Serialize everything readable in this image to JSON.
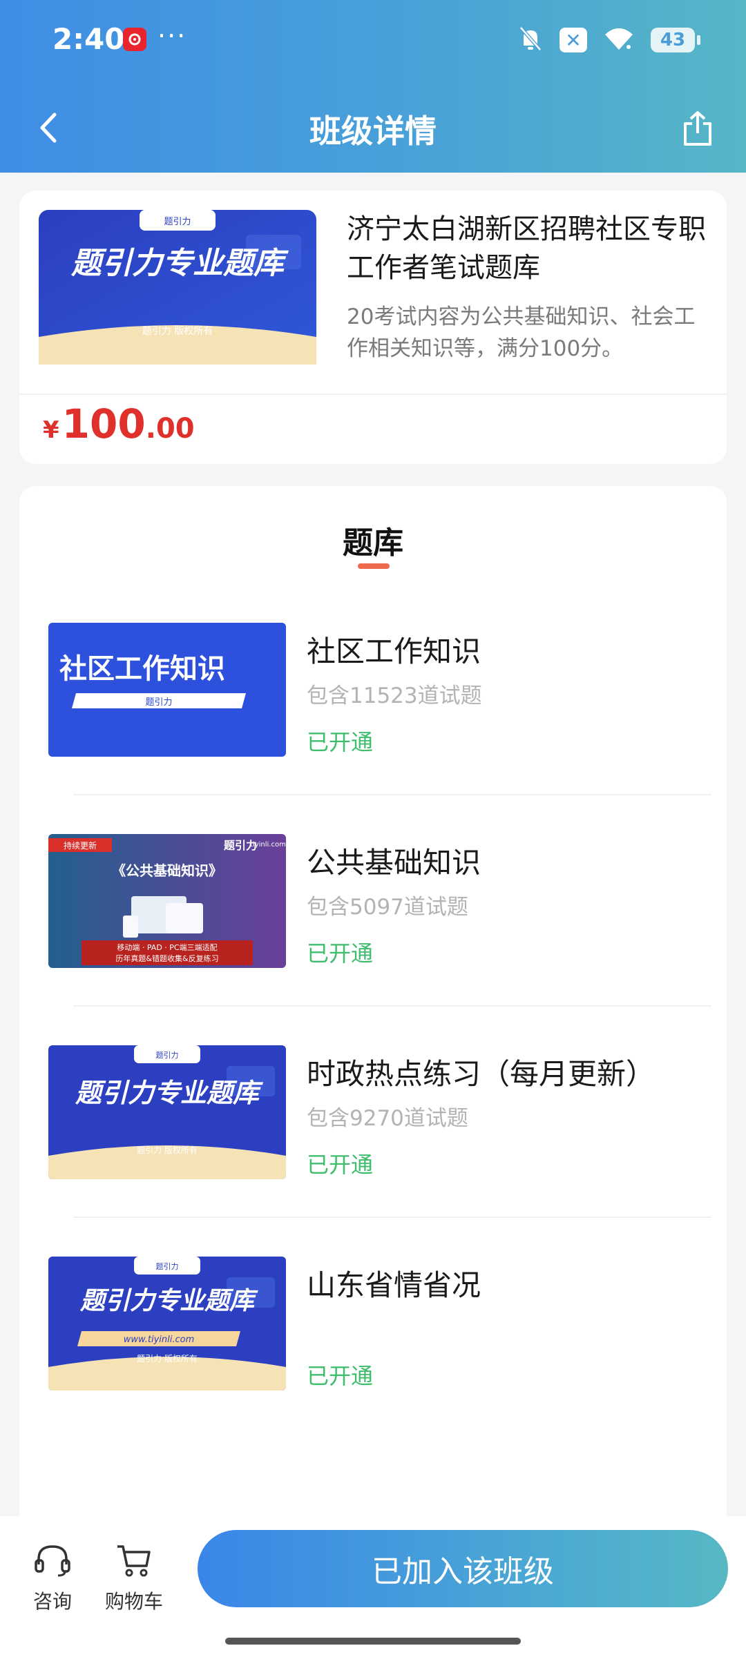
{
  "status_bar": {
    "time": "2:40",
    "dots": "···",
    "battery": "43"
  },
  "nav": {
    "title": "班级详情"
  },
  "class_info": {
    "title": "济宁太白湖新区招聘社区专职工作者笔试题库",
    "description": "20考试内容为公共基础知识、社会工作相关知识等，满分100分。",
    "price_currency": "¥",
    "price_integer": "100",
    "price_decimal": ".00",
    "thumb": {
      "top_label": "题引力",
      "heading": "题引力专业题库",
      "footer": "题引力 版权所有"
    }
  },
  "bank_section": {
    "title": "题库",
    "items": [
      {
        "name": "社区工作知识",
        "count": "包含11523道试题",
        "status": "已开通",
        "thumb": {
          "heading": "社区工作知识",
          "sub": "题引力"
        }
      },
      {
        "name": "公共基础知识",
        "count": "包含5097道试题",
        "status": "已开通",
        "thumb": {
          "badge": "持续更新",
          "brand": "题引力",
          "site": "tiyinli.com",
          "heading": "《公共基础知识》",
          "banner1": "移动端 · PAD · PC端三端适配",
          "banner2": "历年真题&错题收集&反复练习"
        }
      },
      {
        "name": "时政热点练习（每月更新）",
        "count": "包含9270道试题",
        "status": "已开通",
        "thumb": {
          "top_label": "题引力",
          "heading": "题引力专业题库",
          "footer": "题引力 版权所有"
        }
      },
      {
        "name": "山东省情省况",
        "count": "",
        "status": "已开通",
        "thumb": {
          "top_label": "题引力",
          "heading": "题引力专业题库",
          "url": "www.tiyinli.com",
          "footer": "题引力 版权所有"
        }
      }
    ]
  },
  "bottom_bar": {
    "consult_label": "咨询",
    "cart_label": "购物车",
    "join_label": "已加入该班级"
  },
  "colors": {
    "header_start": "#3f8de6",
    "header_end": "#56b6c6",
    "price_red": "#e0302b",
    "status_green": "#3ebd6d",
    "underline": "#ef6a4d",
    "thumb_blue": "#2a45c4"
  }
}
